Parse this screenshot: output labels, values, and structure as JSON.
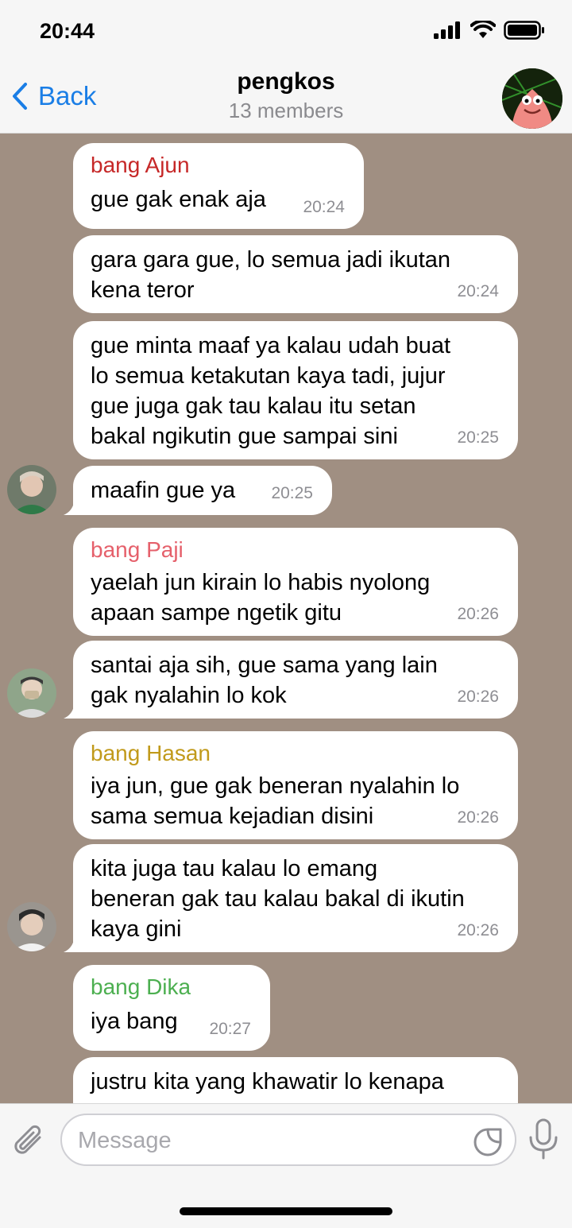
{
  "status": {
    "time": "20:44"
  },
  "header": {
    "back_label": "Back",
    "title": "pengkos",
    "subtitle": "13 members"
  },
  "messages": [
    {
      "sender": "bang Ajun",
      "sender_color": "#c62828",
      "text": "gue gak enak aja",
      "time": "20:24"
    },
    {
      "text": "gara gara gue, lo semua jadi ikutan\nkena teror",
      "time": "20:24"
    },
    {
      "text": "gue minta maaf ya kalau udah buat\nlo semua ketakutan kaya tadi, jujur\ngue juga gak tau kalau itu setan\nbakal ngikutin gue sampai sini",
      "time": "20:25"
    },
    {
      "text": "maafin gue ya",
      "time": "20:25"
    },
    {
      "sender": "bang Paji",
      "sender_color": "#e5606b",
      "text": "yaelah jun kirain lo habis nyolong\napaan sampe ngetik gitu",
      "time": "20:26"
    },
    {
      "text": "santai aja sih, gue sama yang lain\ngak nyalahin lo kok",
      "time": "20:26"
    },
    {
      "sender": "bang Hasan",
      "sender_color": "#c19a1b",
      "text": "iya jun, gue gak beneran nyalahin lo\nsama semua kejadian disini",
      "time": "20:26"
    },
    {
      "text": "kita juga tau kalau lo emang\nbeneran gak tau kalau bakal di ikutin\nkaya gini",
      "time": "20:26"
    },
    {
      "sender": "bang Dika",
      "sender_color": "#4caf50",
      "text": "iya bang",
      "time": "20:27"
    },
    {
      "text": "justru kita yang khawatir lo kenapa",
      "time": ""
    }
  ],
  "input": {
    "placeholder": "Message",
    "value": ""
  },
  "colors": {
    "chat_background": "#a08f82",
    "accent": "#1a7ee6",
    "bubble": "#ffffff"
  },
  "icons": [
    "back-chevron-icon",
    "signal-icon",
    "wifi-icon",
    "battery-icon",
    "attach-icon",
    "sticker-icon",
    "mic-icon"
  ]
}
